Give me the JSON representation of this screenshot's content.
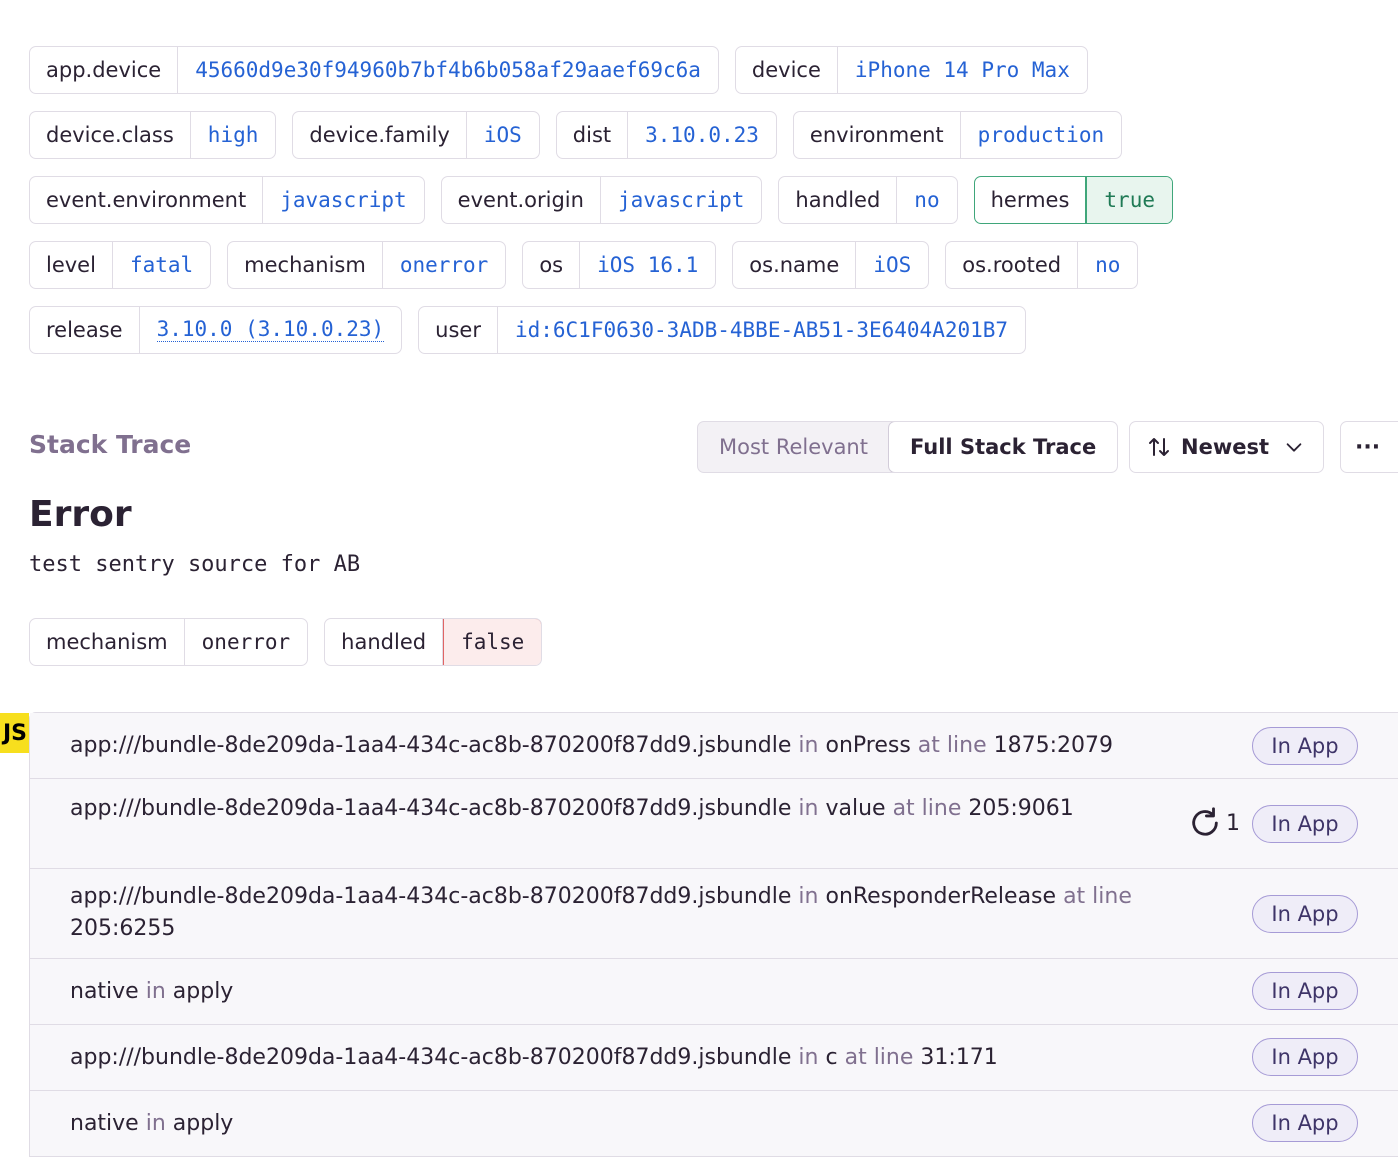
{
  "tags": [
    [
      {
        "key": "app.device",
        "value": "45660d9e30f94960b7bf4b6b058af29aaef69c6a"
      },
      {
        "key": "device",
        "value": "iPhone 14 Pro Max"
      }
    ],
    [
      {
        "key": "device.class",
        "value": "high"
      },
      {
        "key": "device.family",
        "value": "iOS"
      },
      {
        "key": "dist",
        "value": "3.10.0.23"
      },
      {
        "key": "environment",
        "value": "production"
      }
    ],
    [
      {
        "key": "event.environment",
        "value": "javascript"
      },
      {
        "key": "event.origin",
        "value": "javascript"
      },
      {
        "key": "handled",
        "value": "no"
      },
      {
        "key": "hermes",
        "value": "true"
      }
    ],
    [
      {
        "key": "level",
        "value": "fatal"
      },
      {
        "key": "mechanism",
        "value": "onerror"
      },
      {
        "key": "os",
        "value": "iOS 16.1"
      },
      {
        "key": "os.name",
        "value": "iOS"
      },
      {
        "key": "os.rooted",
        "value": "no"
      }
    ],
    [
      {
        "key": "release",
        "value": "3.10.0 (3.10.0.23)"
      },
      {
        "key": "user",
        "value": "id:6C1F0630-3ADB-4BBE-AB51-3E6404A201B7"
      }
    ]
  ],
  "stack_trace": {
    "title": "Stack Trace",
    "view_options": [
      "Most Relevant",
      "Full Stack Trace"
    ],
    "active_view": "Full Stack Trace",
    "sort_label": "Newest",
    "more_label": "···"
  },
  "error": {
    "type": "Error",
    "message": "test sentry source for AB",
    "mechanism_key": "mechanism",
    "mechanism_value": "onerror",
    "handled_key": "handled",
    "handled_value": "false"
  },
  "platform_badge": "JS",
  "frames": [
    {
      "file": "app:///bundle-8de209da-1aa4-434c-ac8b-870200f87dd9.jsbundle",
      "in": "in",
      "function": "onPress",
      "at": "at line",
      "line": "1875:2079",
      "repeat": "",
      "badge": "In App"
    },
    {
      "file": "app:///bundle-8de209da-1aa4-434c-ac8b-870200f87dd9.jsbundle",
      "in": "in",
      "function": "value",
      "at": "at line",
      "line": "205:9061",
      "repeat": "1",
      "badge": "In App"
    },
    {
      "file": "app:///bundle-8de209da-1aa4-434c-ac8b-870200f87dd9.jsbundle",
      "in": "in",
      "function": "onResponderRelease",
      "at": "at line",
      "line": "205:6255",
      "repeat": "",
      "badge": "In App"
    },
    {
      "file": "native",
      "in": "in",
      "function": "apply",
      "at": "",
      "line": "",
      "repeat": "",
      "badge": "In App"
    },
    {
      "file": "app:///bundle-8de209da-1aa4-434c-ac8b-870200f87dd9.jsbundle",
      "in": "in",
      "function": "c",
      "at": "at line",
      "line": "31:171",
      "repeat": "",
      "badge": "In App"
    },
    {
      "file": "native",
      "in": "in",
      "function": "apply",
      "at": "",
      "line": "",
      "repeat": "",
      "badge": "In App"
    }
  ],
  "colors": {
    "accent_value": "#2562d4",
    "muted": "#80708f",
    "in_app_border": "#a69bd6",
    "handled_false": "#e06464",
    "hermes_true": "#3fa67a"
  }
}
